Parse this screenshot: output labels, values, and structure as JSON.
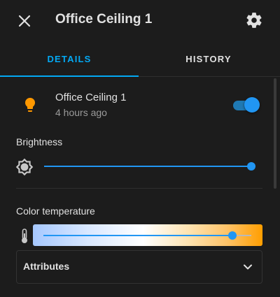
{
  "header": {
    "title": "Office Ceiling 1"
  },
  "tabs": [
    {
      "label": "DETAILS"
    },
    {
      "label": "HISTORY"
    }
  ],
  "entity": {
    "name": "Office Ceiling 1",
    "last_changed": "4 hours ago",
    "state_on": true
  },
  "brightness": {
    "label": "Brightness",
    "value_fraction": 1.0
  },
  "color_temperature": {
    "label": "Color temperature",
    "value_fraction": 0.91
  },
  "attributes": {
    "label": "Attributes"
  },
  "icons": {
    "close": "close-icon",
    "settings": "gear-icon",
    "bulb": "lightbulb-icon",
    "brightness": "sun-icon",
    "temperature": "thermometer-icon",
    "expand": "chevron-down-icon"
  },
  "colors": {
    "accent": "#03a9f4",
    "bulb_on": "#ff9800",
    "background": "#1c1c1c"
  }
}
